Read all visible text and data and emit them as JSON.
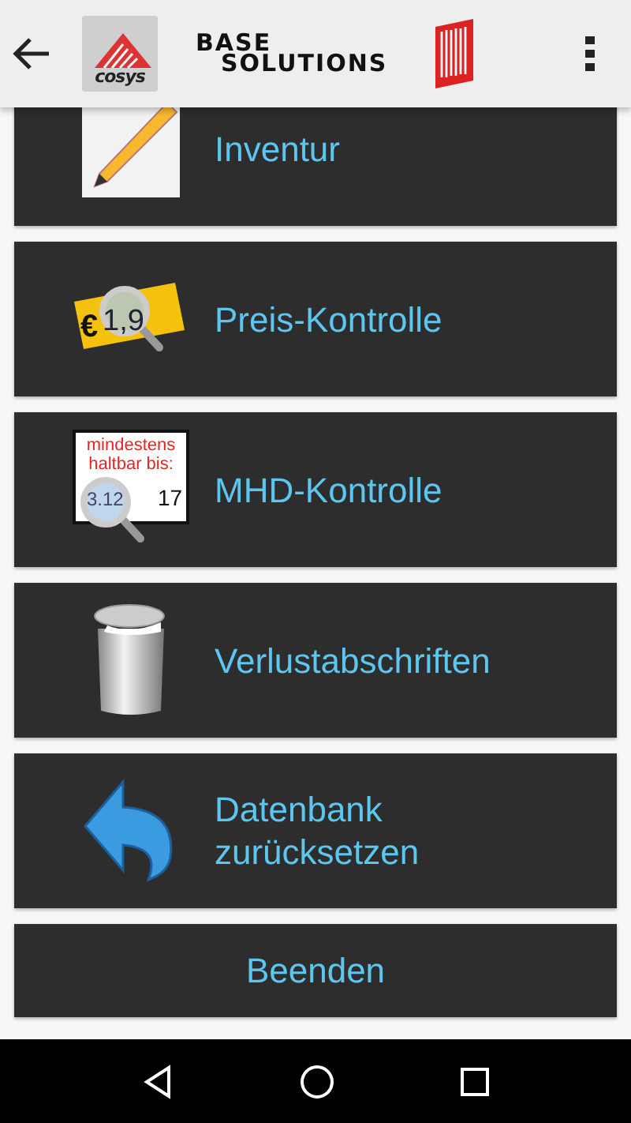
{
  "app_bar": {
    "logo_text": "cosys",
    "title_line_1": "BASE",
    "title_line_2": "SOLUTIONS"
  },
  "menu": [
    {
      "label": "Inventur",
      "kind": "pencil"
    },
    {
      "label": "Preis-Kontrolle",
      "kind": "price",
      "icon_texts": [
        "€",
        "1,9"
      ]
    },
    {
      "label": "MHD-Kontrolle",
      "kind": "date",
      "icon_texts": [
        "mindestens",
        "haltbar bis:",
        "3.12",
        "17"
      ]
    },
    {
      "label": "Verlustabschriften",
      "kind": "bin"
    },
    {
      "label": "Datenbank zurücksetzen",
      "kind": "undo"
    },
    {
      "label": "Beenden",
      "kind": "plain"
    }
  ]
}
